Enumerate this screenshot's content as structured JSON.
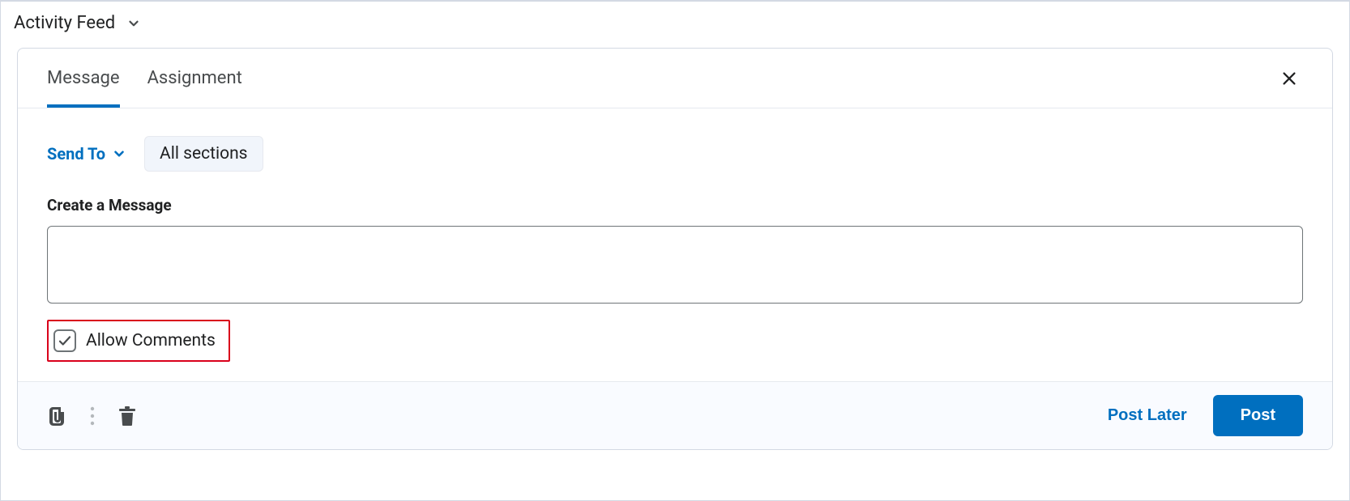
{
  "header": {
    "title": "Activity Feed"
  },
  "tabs": {
    "message": "Message",
    "assignment": "Assignment"
  },
  "sendTo": {
    "label": "Send To",
    "chip": "All sections"
  },
  "message": {
    "label": "Create a Message",
    "value": ""
  },
  "allowComments": {
    "label": "Allow Comments",
    "checked": true
  },
  "footer": {
    "postLater": "Post Later",
    "post": "Post"
  }
}
